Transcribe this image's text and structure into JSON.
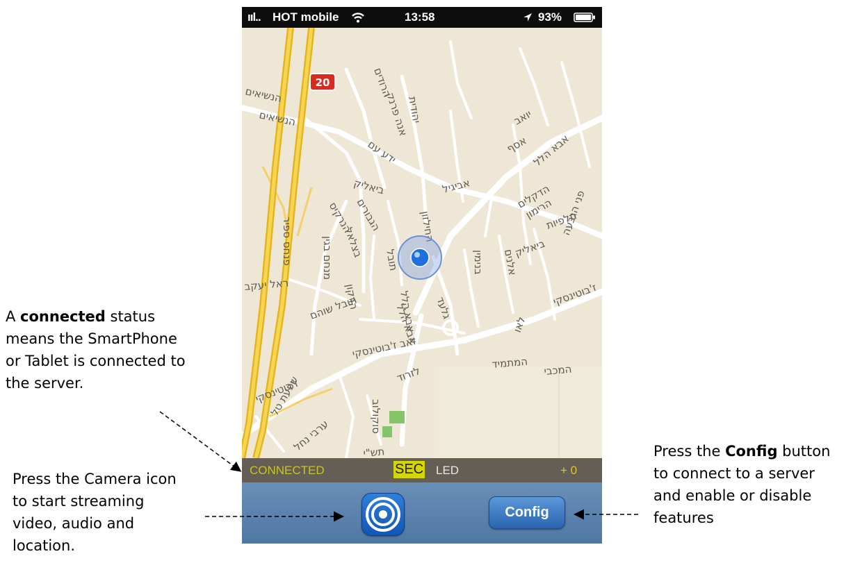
{
  "status_bar": {
    "signal": "ııl..",
    "carrier": "HOT mobile",
    "time": "13:58",
    "battery": "93%",
    "icons": [
      "signal-icon",
      "wifi-icon",
      "location-arrow-icon",
      "battery-icon"
    ]
  },
  "map": {
    "route_shield": "20",
    "streets": [
      "הנשיאים",
      "הנשיאים",
      "הרודים",
      "אנה פרנק",
      "ידע עם",
      "יהודית",
      "יואב",
      "אסף",
      "אביגיל",
      "אבא הלל",
      "ביאליק",
      "הנרקיס",
      "הגבורים",
      "הדקלים",
      "הרימון",
      "תלפיות",
      "פני הגבעה",
      "ביאליק",
      "פנחס ספיר",
      "מנחם בגין",
      "בצלאל",
      "החילזון",
      "תובל",
      "אבא הלל",
      "הרקון",
      "תובל שוהם",
      "בנימין",
      "אלנים",
      "ז'בוטינסקי",
      "ראל יעקב",
      "זאב ז'בוטינסקי",
      "גלעד",
      "אבא הלל",
      "לאו",
      "המכבי",
      "המתמיד",
      "ז'בוטינסקי",
      "לזרוד",
      "סוקולוב",
      "שפעת טל",
      "ערבי נחל",
      "תש\"י"
    ]
  },
  "status_strip": {
    "connection": "CONNECTED",
    "sec": "SEC",
    "led": "LED",
    "counter": "+ 0"
  },
  "toolbar": {
    "config_label": "Config"
  },
  "annotations": {
    "connected": {
      "prefix": "A ",
      "bold": "connected",
      "suffix": " status",
      "line2": "means the SmartPhone",
      "line3": "or Tablet is connected to",
      "line4": "the server."
    },
    "camera": {
      "line1": "Press the Camera icon",
      "line2": "to start streaming",
      "line3": "video, audio and",
      "line4": "location."
    },
    "config": {
      "prefix": "Press the ",
      "bold": "Config",
      "suffix": " button",
      "line2": "to connect to a server",
      "line3": "and enable or disable",
      "line4": "features"
    }
  },
  "colors": {
    "connected_text": "#c9c427",
    "sec_bg": "#d4d600",
    "led_text": "#e8e8e8",
    "counter_text": "#d7c93a",
    "toolbar": "#5a80aa",
    "config_button": "#3b74bf"
  }
}
